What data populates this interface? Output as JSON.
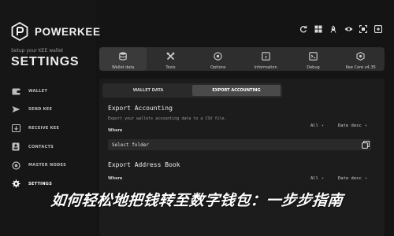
{
  "brand": {
    "name": "POWERKEE",
    "setup_text": "Setup your KEE wallet",
    "section_heading": "SETTINGS"
  },
  "sidebar": {
    "items": [
      {
        "label": "WALLET",
        "icon": "wallet-icon"
      },
      {
        "label": "SEND KEE",
        "icon": "send-icon"
      },
      {
        "label": "RECEIVE KEE",
        "icon": "receive-icon"
      },
      {
        "label": "CONTACTS",
        "icon": "contacts-icon"
      },
      {
        "label": "MASTER NODES",
        "icon": "masternodes-icon"
      },
      {
        "label": "SETTINGS",
        "icon": "gear-icon",
        "active": true
      }
    ]
  },
  "top_icons": [
    "refresh-icon",
    "grid-icon",
    "rocket-icon",
    "eye-icon",
    "scan-icon",
    "settings-icon"
  ],
  "toolbar": {
    "items": [
      {
        "label": "Wallet data",
        "icon": "database-icon",
        "active": true
      },
      {
        "label": "Tools",
        "icon": "tools-icon"
      },
      {
        "label": "Options",
        "icon": "options-icon"
      },
      {
        "label": "Information",
        "icon": "info-icon"
      },
      {
        "label": "Debug",
        "icon": "debug-icon"
      },
      {
        "label": "Kee Core v4.35",
        "icon": "core-icon"
      }
    ]
  },
  "subtabs": [
    {
      "label": "WALLET DATA"
    },
    {
      "label": "EXPORT ACCOUNTING",
      "active": true
    }
  ],
  "export_accounting": {
    "title": "Export Accounting",
    "description": "Export your wallets accounting data to a CSV file.",
    "where_label": "Where",
    "filter_all": "All",
    "filter_date": "Date desc",
    "folder_value": "Select folder"
  },
  "export_address_book": {
    "title": "Export Address Book",
    "where_label": "Where",
    "filter_all": "All",
    "filter_date": "Date desc"
  },
  "overlay_headline": "如何轻松地把钱转至数字钱包：一步步指南",
  "colors": {
    "background": "#141414",
    "panel": "#1c1c1c",
    "toolbar": "#2e2e2e",
    "accent_text": "#ffffff"
  }
}
